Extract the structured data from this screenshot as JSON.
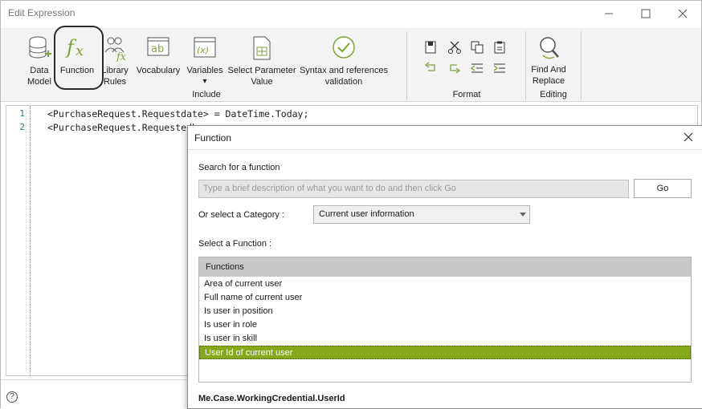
{
  "window": {
    "title": "Edit Expression",
    "minimize_icon": "minimize-icon",
    "maximize_icon": "maximize-icon",
    "close_icon": "close-icon"
  },
  "ribbon": {
    "buttons": [
      {
        "label": "Data\nModel",
        "icon": "database-icon"
      },
      {
        "label": "Function",
        "icon": "function-fx-icon"
      },
      {
        "label": "Library\nRules",
        "icon": "library-rules-icon"
      },
      {
        "label": "Vocabulary",
        "icon": "vocabulary-icon"
      },
      {
        "label": "Variables",
        "icon": "variables-icon"
      },
      {
        "label": "Select Parameter\nValue",
        "icon": "select-parameter-icon"
      },
      {
        "label": "Syntax and references\nvalidation",
        "icon": "validation-check-icon"
      },
      {
        "label": "Find And\nReplace",
        "icon": "find-replace-icon"
      }
    ],
    "groups": {
      "include": "Include",
      "format": "Format",
      "editing": "Editing"
    },
    "variables_arrow": "▾",
    "accent_color": "#7ea33a"
  },
  "editor": {
    "lines": [
      {
        "num": "1",
        "text": "<PurchaseRequest.Requestdate> = DateTime.Today;"
      },
      {
        "num": "2",
        "text": "<PurchaseRequest.Requestedby>"
      }
    ]
  },
  "statusbar": {
    "help": "?"
  },
  "dialog": {
    "title": "Function",
    "search_label": "Search for a function",
    "search_placeholder": "Type a brief description of what you want to do and then click Go",
    "go_label": "Go",
    "category_label": "Or select a Category :",
    "category_value": "Current user information",
    "function_label": "Select a Function :",
    "list_header": "Functions",
    "functions": [
      "Area of current user",
      "Full name of current user",
      "Is user in position",
      "Is user in role",
      "Is user in skill",
      "User Id of current user"
    ],
    "selected_index": 5,
    "selected_color": "#88a81b",
    "expression": "Me.Case.WorkingCredential.UserId"
  }
}
